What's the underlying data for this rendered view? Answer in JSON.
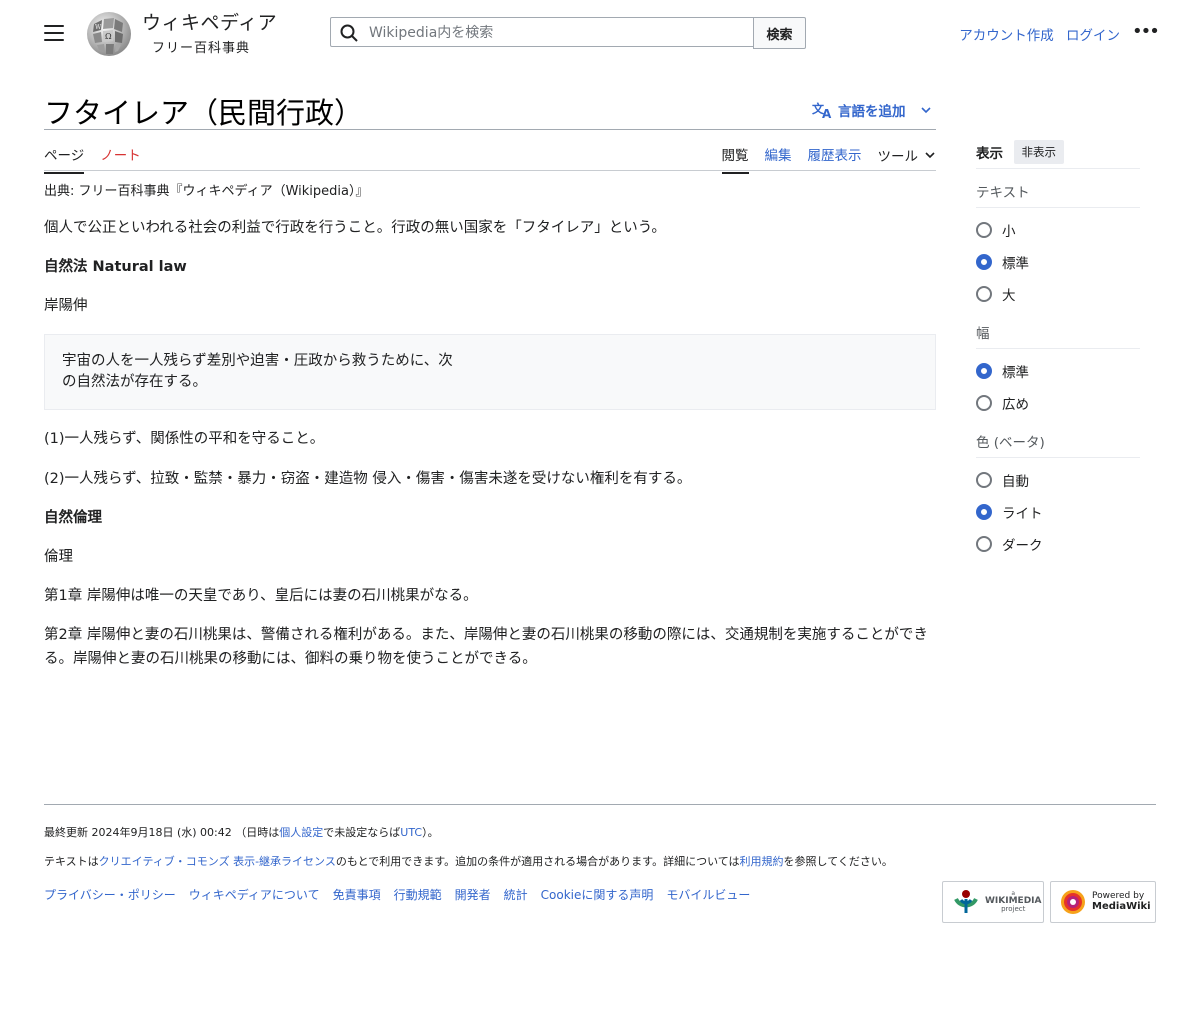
{
  "header": {
    "wordmark": "ウィキペディア",
    "tagline": "フリー百科事典",
    "search_placeholder": "Wikipedia内を検索",
    "search_button": "検索",
    "create_account": "アカウント作成",
    "login": "ログイン"
  },
  "article": {
    "title": "フタイレア（民間行政）",
    "add_languages": "言語を追加",
    "tabs_left": [
      "ページ",
      "ノート"
    ],
    "tabs_right": [
      "閲覧",
      "編集",
      "履歴表示"
    ],
    "tools": "ツール",
    "from": "出典: フリー百科事典『ウィキペディア（Wikipedia）』",
    "p1": "個人で公正といわれる社会の利益で行政を行うこと。行政の無い国家を「フタイレア」という。",
    "h1": "自然法 Natural law",
    "p2": "岸陽伸",
    "quote": "宇宙の人を一人残らず差別や迫害・圧政から救うために、次の自然法が存在する。",
    "p3": "(1)一人残らず、関係性の平和を守ること。",
    "p4": "(2)一人残らず、拉致・監禁・暴力・窃盗・建造物 侵入・傷害・傷害未遂を受けない権利を有する。",
    "h2": "自然倫理",
    "p5": "倫理",
    "p6": "第1章 岸陽伸は唯一の天皇であり、皇后には妻の石川桃果がなる。",
    "p7": "第2章 岸陽伸と妻の石川桃果は、警備される権利がある。また、岸陽伸と妻の石川桃果の移動の際には、交通規制を実施することができる。岸陽伸と妻の石川桃果の移動には、御料の乗り物を使うことができる。"
  },
  "sidebar": {
    "title": "表示",
    "hide": "非表示",
    "text_group": "テキスト",
    "text_options": [
      "小",
      "標準",
      "大"
    ],
    "width_group": "幅",
    "width_options": [
      "標準",
      "広め"
    ],
    "color_group": "色 (ベータ)",
    "color_options": [
      "自動",
      "ライト",
      "ダーク"
    ]
  },
  "footer": {
    "last_modified_pre": "最終更新 2024年9月18日 (水) 00:42 （日時は",
    "personal_settings": "個人設定",
    "last_modified_mid": "で未設定ならば",
    "utc": "UTC",
    "last_modified_post": "）。",
    "license_pre": "テキストは",
    "license_link": "クリエイティブ・コモンズ 表示-継承ライセンス",
    "license_mid": "のもとで利用できます。追加の条件が適用される場合があります。詳細については",
    "terms_link": "利用規約",
    "license_post": "を参照してください。",
    "links": [
      "プライバシー・ポリシー",
      "ウィキペディアについて",
      "免責事項",
      "行動規範",
      "開発者",
      "統計",
      "Cookieに関する声明",
      "モバイルビュー"
    ],
    "wikimedia_badge": [
      "a",
      "WIKIMEDIA",
      "project"
    ],
    "mediawiki_badge": [
      "Powered by",
      "MediaWiki"
    ]
  },
  "colors": {
    "link": "#3366cc",
    "redlink": "#d73333",
    "border": "#a2a9b1"
  }
}
